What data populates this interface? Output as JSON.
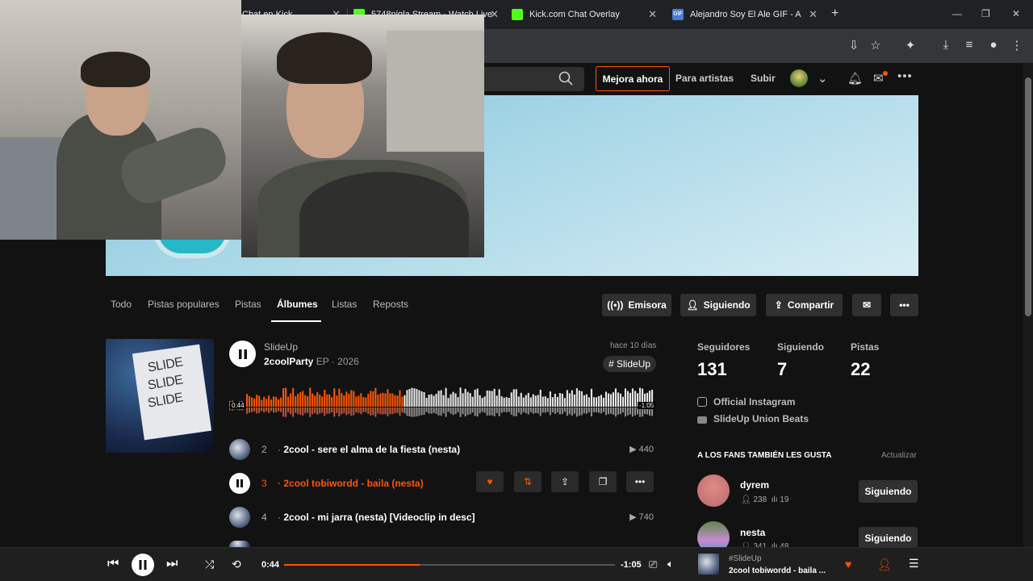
{
  "browser": {
    "tabs": [
      {
        "label": "Chat en Kick",
        "favicon_color": "#53fc18"
      },
      {
        "label": "5748nigla Stream - Watch Live",
        "favicon_color": "#53fc18"
      },
      {
        "label": "Kick.com Chat Overlay",
        "favicon_color": "#53fc18"
      },
      {
        "label": "Alejandro Soy El Ale GIF - Alejan",
        "favicon_color": "#4a7dd4"
      }
    ],
    "favicon_text": "GIF"
  },
  "header": {
    "upgrade_label": "Mejora ahora",
    "for_artists_label": "Para artistas",
    "upload_label": "Subir",
    "accent_color": "#ff5500"
  },
  "profile_tabs": [
    "Todo",
    "Pistas populares",
    "Pistas",
    "Álbumes",
    "Listas",
    "Reposts"
  ],
  "actions": {
    "station": "Emisora",
    "following": "Siguiendo",
    "share": "Compartir"
  },
  "album": {
    "artist": "SlideUp",
    "title": "2coolParty",
    "meta": "EP · 2026",
    "date": "hace 10 días",
    "tag": "# SlideUp",
    "art_text": [
      "SLIDE",
      "SLIDE",
      "SLIDE"
    ],
    "waveform_current": "0:44",
    "waveform_remaining": "-1:05",
    "progress": 0.41
  },
  "tracks": [
    {
      "num": "2",
      "title": "2cool - sere el alma de la fiesta (nesta)",
      "plays": "440"
    },
    {
      "num": "3",
      "title": "2cool tobiwordd - baila (nesta)",
      "plays": ""
    },
    {
      "num": "4",
      "title": "2cool - mi jarra (nesta) [Videoclip in desc]",
      "plays": "740"
    }
  ],
  "stats": {
    "followers_label": "Seguidores",
    "followers": "131",
    "following_label": "Siguiendo",
    "following": "7",
    "tracks_label": "Pistas",
    "tracks": "22"
  },
  "links": [
    "Official Instagram",
    "SlideUp Union Beats"
  ],
  "fans": {
    "heading": "A LOS FANS TAMBIÉN LES GUSTA",
    "refresh": "Actualizar",
    "items": [
      {
        "name": "dyrem",
        "followers": "238",
        "tracks": "19",
        "button": "Siguiendo"
      },
      {
        "name": "nesta",
        "followers": "341",
        "tracks": "48",
        "button": "Siguiendo"
      }
    ]
  },
  "player": {
    "elapsed": "0:44",
    "remaining": "-1:05",
    "progress": 0.41,
    "now_artist": "#SlideUp",
    "now_title": "2cool tobiwordd - baila ..."
  }
}
